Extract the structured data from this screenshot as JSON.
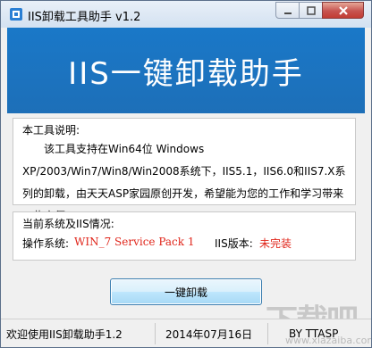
{
  "window": {
    "title": "IIS卸载工具助手 v1.2",
    "icon": "app-icon"
  },
  "banner": {
    "title": "IIS一键卸载助手"
  },
  "description": {
    "caption": "本工具说明:",
    "text": "该工具支持在Win64位 Windows XP/2003/Win7/Win8/Win2008系统下，IIS5.1，IIS6.0和IIS7.X系列的卸载，由天天ASP家园原创开发，希望能为您的工作和学习带来一些方便。"
  },
  "system": {
    "caption": "当前系统及IIS情况:",
    "os_label": "操作系统:",
    "os_value": "WIN_7  Service Pack 1",
    "iis_label": "IIS版本:",
    "iis_value": "未完装",
    "value_color": "#e0261b"
  },
  "actions": {
    "uninstall_label": "一键卸载"
  },
  "statusbar": {
    "welcome": "欢迎使用IIS卸载助手1.2",
    "date": "2014年07月16日",
    "author": "BY TTASP"
  },
  "watermark": {
    "logo": "下载吧",
    "url": "www.xiazaiba.com"
  }
}
